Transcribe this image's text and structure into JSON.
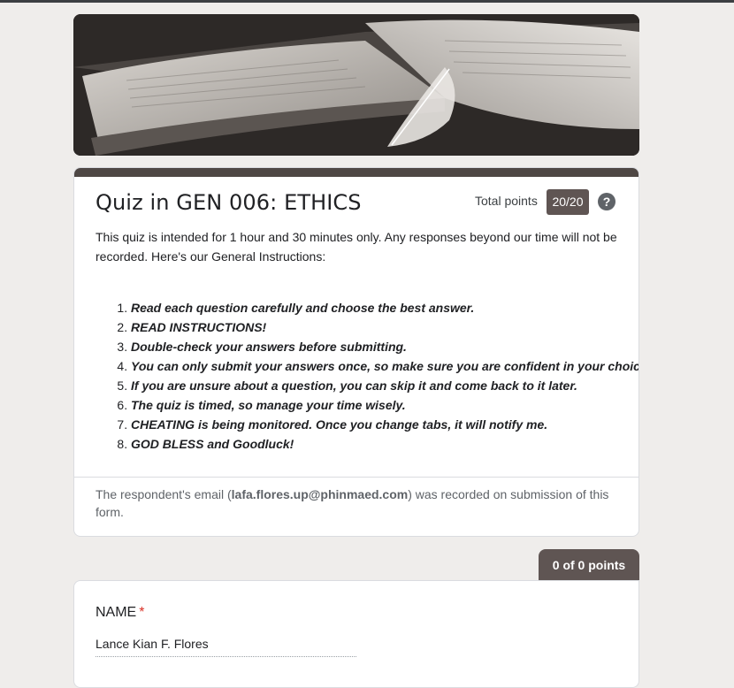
{
  "form": {
    "title": "Quiz in GEN 006: ETHICS",
    "total_points_label": "Total points",
    "total_points_value": "20/20",
    "help_glyph": "?",
    "intro": "This quiz is intended for 1 hour and 30 minutes only. Any responses beyond our time will not be recorded. Here's our General Instructions:",
    "rules": [
      "Read each question carefully and choose the best answer.",
      "READ INSTRUCTIONS!",
      "Double-check your answers before submitting.",
      "You can only submit your answers once, so make sure you are confident in your choices.",
      "If you are unsure about a question, you can skip it and come back to it later.",
      "The quiz is timed, so manage your time wisely.",
      "CHEATING is being monitored. Once you change tabs, it will notify me.",
      "GOD BLESS and Goodluck!"
    ],
    "email_prefix": "The respondent's email (",
    "email": "lafa.flores.up@phinmaed.com",
    "email_suffix": ") was recorded on submission of this form."
  },
  "section_score": "0 of 0 points",
  "name_question": {
    "label": "NAME",
    "required_mark": "*",
    "answer": "Lance Kian F. Flores"
  },
  "colors": {
    "theme": "#4e4744",
    "badge": "#5f5553",
    "background": "#efedeb",
    "required": "#d93025"
  },
  "icons": {
    "header_image": "open-book-with-feather-image",
    "help": "help-circle-icon"
  }
}
